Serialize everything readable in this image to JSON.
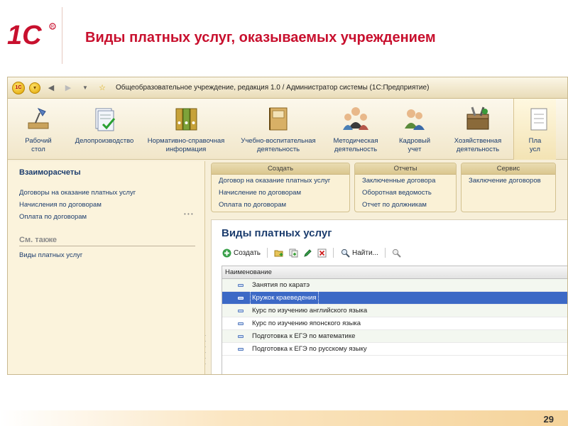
{
  "slide": {
    "title": "Виды платных услуг, оказываемых учреждением",
    "logo_text": "1С",
    "page_number": "29",
    "colors": {
      "title": "#c8102e",
      "logo": "#c8102e",
      "accent": "#3c69c6"
    }
  },
  "window": {
    "title": "Общеобразовательное учреждение, редакция 1.0 / Администратор системы  (1С:Предприятие)",
    "icons": [
      "app-1c-icon",
      "menu-round-icon",
      "back-arrow-icon",
      "forward-arrow-icon",
      "history-dropdown-icon",
      "favorites-star-icon"
    ]
  },
  "sections": [
    {
      "label1": "Рабочий",
      "label2": "стол",
      "icon": "desk-lamp-icon"
    },
    {
      "label1": "Делопроизводство",
      "label2": "",
      "icon": "documents-check-icon"
    },
    {
      "label1": "Нормативно-справочная",
      "label2": "информация",
      "icon": "binders-icon"
    },
    {
      "label1": "Учебно-воспитательная",
      "label2": "деятельность",
      "icon": "book-icon"
    },
    {
      "label1": "Методическая",
      "label2": "деятельность",
      "icon": "people-group-icon"
    },
    {
      "label1": "Кадровый",
      "label2": "учет",
      "icon": "staff-icon"
    },
    {
      "label1": "Хозяйственная",
      "label2": "деятельность",
      "icon": "toolbox-icon"
    },
    {
      "label1": "Пла",
      "label2": "усл",
      "icon": "paid-services-icon"
    }
  ],
  "nav": {
    "group_title": "Взаиморасчеты",
    "links": [
      "Договоры на оказание платных услуг",
      "Начисления по договорам",
      "Оплата по договорам"
    ],
    "see_also_title": "См. также",
    "see_also_links": [
      "Виды платных услуг"
    ]
  },
  "actions": {
    "create": {
      "title": "Создать",
      "items": [
        "Договор на оказание платных услуг",
        "Начисление по договорам",
        "Оплата по договорам"
      ]
    },
    "reports": {
      "title": "Отчеты",
      "items": [
        "Заключенные договора",
        "Оборотная ведомость",
        "Отчет по должникам"
      ]
    },
    "service": {
      "title": "Сервис",
      "items": [
        "Заключение договоров"
      ]
    }
  },
  "form": {
    "title": "Виды платных услуг",
    "toolbar": {
      "create_label": "Создать",
      "find_label": "Найти..."
    },
    "column_header": "Наименование",
    "rows": [
      "Занятия по каратэ",
      "Кружок краеведения",
      "Курс по изучению английского языка",
      "Курс по изучению японского языка",
      "Подготовка к ЕГЭ по математике",
      "Подготовка к ЕГЭ по русскому языку"
    ],
    "selected_row": "Кружок краеведения"
  }
}
